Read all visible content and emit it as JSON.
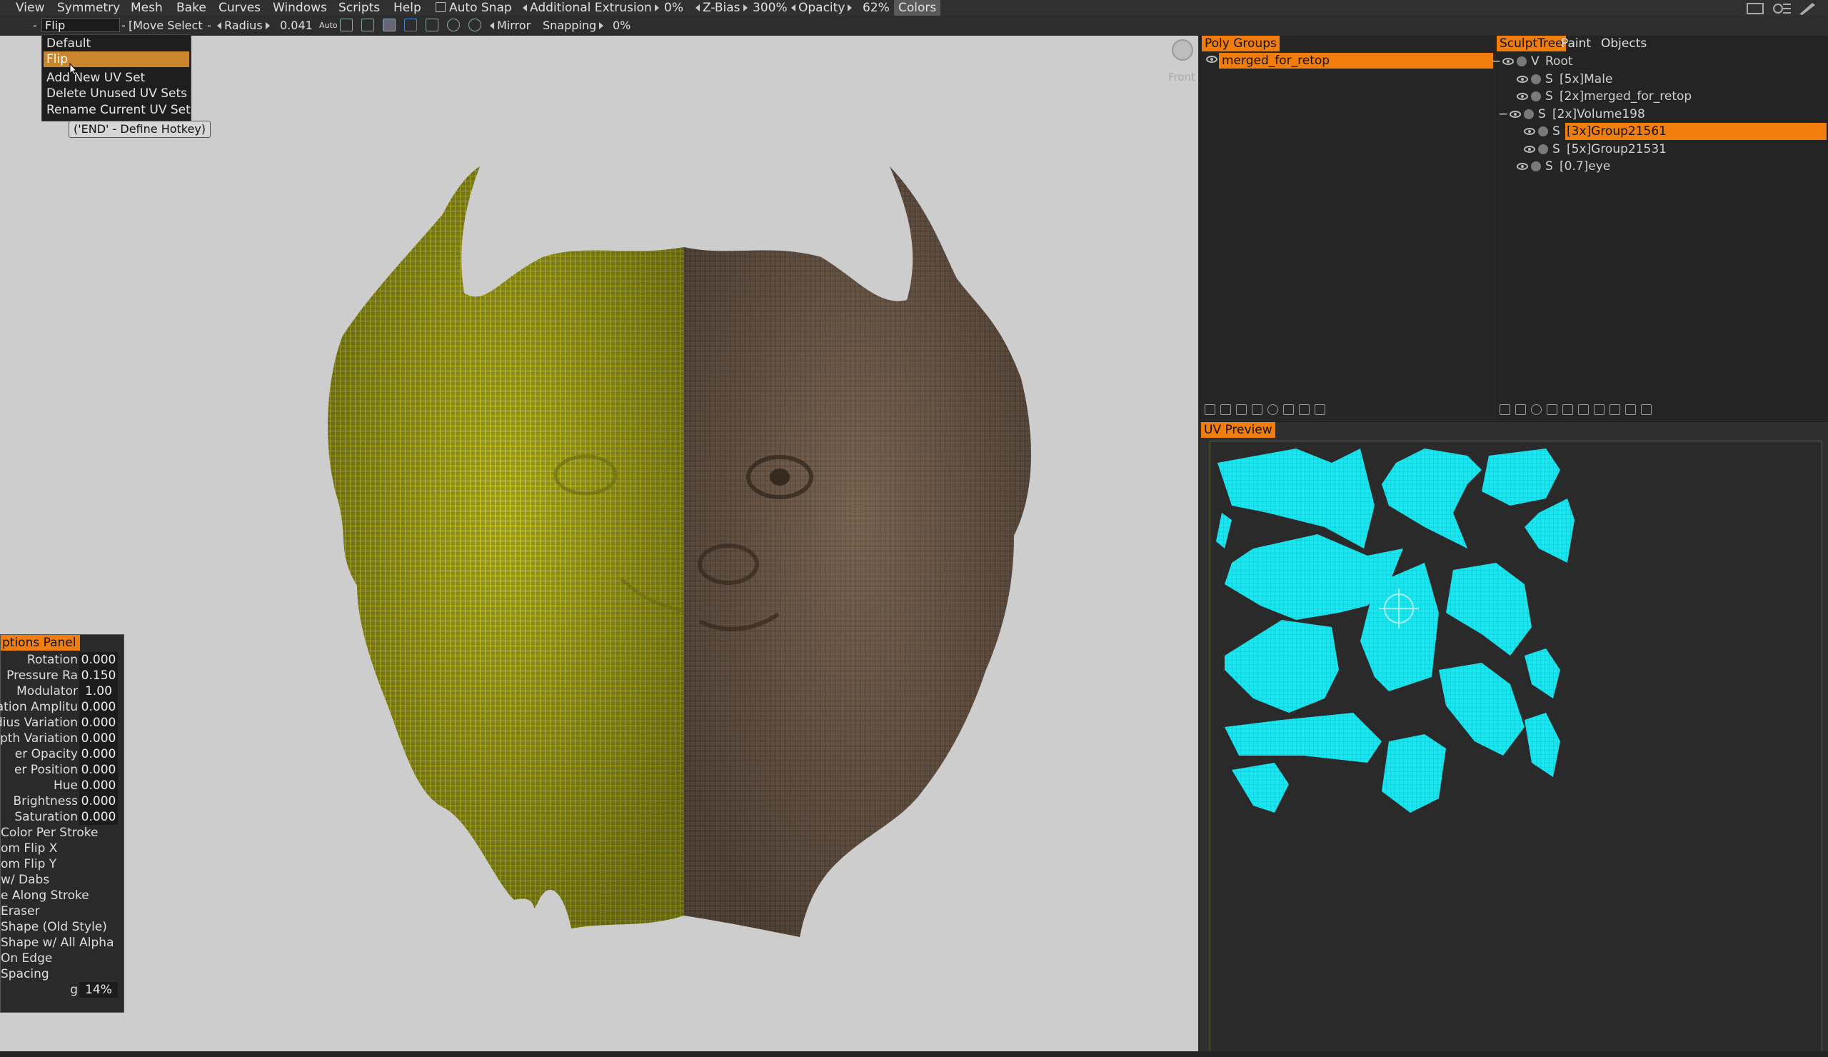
{
  "menu": [
    "View",
    "Symmetry",
    "Mesh",
    "Bake",
    "Curves",
    "Windows",
    "Scripts",
    "Help"
  ],
  "topbar": {
    "auto_snap": "Auto Snap",
    "additional_extrusion": "Additional Extrusion",
    "additional_extrusion_value": "0%",
    "z_bias": "Z-Bias",
    "z_bias_value": "300%",
    "opacity": "Opacity",
    "opacity_value": "62%",
    "colors": "Colors"
  },
  "toolbar": {
    "uv_set_combo": "Flip",
    "move_select": "[Move Select",
    "radius": "Radius",
    "radius_value": "0.041",
    "auto": "Auto",
    "mirror": "Mirror",
    "snapping": "Snapping",
    "snapping_value": "0%"
  },
  "uv_menu": {
    "items": [
      "Default",
      "Flip",
      "Add  New  UV  Set",
      "Delete  Unused  UV  Sets",
      "Rename  Current  UV  Set"
    ],
    "selected_index": 1,
    "hotkey_tip": "('END' - Define  Hotkey)"
  },
  "viewport": {
    "view_label": "Front",
    "background": "#cdcdcd",
    "wire_color": "#e8e81a",
    "sculpt_color": "#6b5645"
  },
  "options_panel": {
    "title": "ptions  Panel",
    "rows": [
      {
        "label": "Rotation",
        "value": "0.000"
      },
      {
        "label": "Pressure  Ra",
        "value": "0.150"
      },
      {
        "label": "Modulator",
        "value": "1.00"
      },
      {
        "label": "ation  Amplitu",
        "value": "0.000"
      },
      {
        "label": "dius  Variation",
        "value": "0.000"
      },
      {
        "label": "pth  Variation",
        "value": "0.000"
      },
      {
        "label": "er  Opacity",
        "value": "0.000"
      },
      {
        "label": "er  Position",
        "value": "0.000"
      },
      {
        "label": "Hue",
        "value": "0.000"
      },
      {
        "label": "Brightness",
        "value": "0.000"
      },
      {
        "label": "Saturation",
        "value": "0.000"
      },
      {
        "label": "Color  Per  Stroke",
        "value": ""
      },
      {
        "label": "om  Flip  X",
        "value": ""
      },
      {
        "label": "om  Flip  Y",
        "value": ""
      },
      {
        "label": "w/  Dabs",
        "value": ""
      },
      {
        "label": "e  Along  Stroke",
        "value": ""
      },
      {
        "label": "Eraser",
        "value": ""
      },
      {
        "label": "Shape  (Old  Style)",
        "value": ""
      },
      {
        "label": "Shape  w/  All  Alpha",
        "value": ""
      },
      {
        "label": "On  Edge",
        "value": ""
      },
      {
        "label": "Spacing",
        "value": ""
      },
      {
        "label": "g",
        "value": "14%"
      }
    ]
  },
  "poly_groups": {
    "tab": "Poly  Groups",
    "items": [
      "merged_for_retop"
    ]
  },
  "sculpt_tree": {
    "tabs": [
      "SculptTree",
      "Paint",
      "Objects"
    ],
    "items": [
      {
        "prefix": "V",
        "label": "Root"
      },
      {
        "prefix": "S",
        "label": "[5x]Male"
      },
      {
        "prefix": "S",
        "label": "[2x]merged_for_retop"
      },
      {
        "prefix": "S",
        "label": "[2x]Volume198"
      },
      {
        "prefix": "S",
        "label": "[3x]Group21561"
      },
      {
        "prefix": "S",
        "label": "[5x]Group21531"
      },
      {
        "prefix": "S",
        "label": "[0.7]eye"
      }
    ],
    "selected_index": 4
  },
  "uv_preview": {
    "tab": "UV  Preview",
    "island_color": "#19e6ee"
  }
}
